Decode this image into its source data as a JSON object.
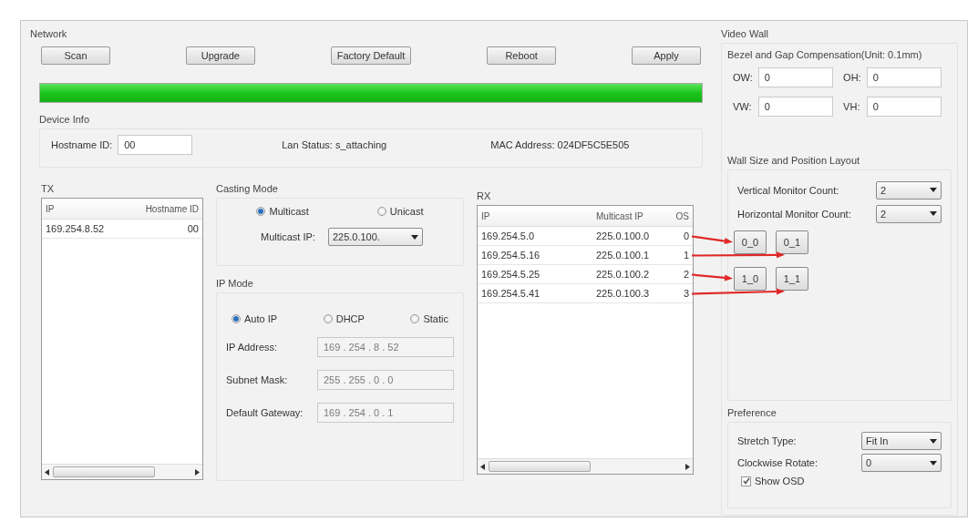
{
  "network": {
    "title": "Network",
    "buttons": [
      "Scan",
      "Upgrade",
      "Factory Default",
      "Reboot",
      "Apply"
    ],
    "progress": {
      "level": 1
    },
    "device_info": {
      "title": "Device Info",
      "hostname_label": "Hostname ID:",
      "hostname_value": "00",
      "lan_status": "Lan Status: s_attaching",
      "mac_address": "MAC Address: 024DF5C5E505"
    }
  },
  "tx": {
    "title": "TX",
    "columns": [
      "IP",
      "Hostname ID"
    ],
    "rows": [
      [
        "169.254.8.52",
        "00"
      ]
    ]
  },
  "casting_mode": {
    "title": "Casting Mode",
    "options": [
      {
        "label": "Multicast",
        "selected": true
      },
      {
        "label": "Unicast",
        "selected": false
      }
    ],
    "multicast_ip_label": "Multicast IP:",
    "multicast_ip": "225.0.100."
  },
  "ip_mode": {
    "title": "IP Mode",
    "options": [
      {
        "label": "Auto IP",
        "selected": true
      },
      {
        "label": "DHCP",
        "selected": false
      },
      {
        "label": "Static",
        "selected": false
      }
    ],
    "fields": [
      {
        "label": "IP Address:",
        "value": "169 . 254 . 8 . 52",
        "disabled": true
      },
      {
        "label": "Subnet Mask:",
        "value": "255 . 255 . 0 . 0",
        "disabled": true
      },
      {
        "label": "Default Gateway:",
        "value": "169 . 254 . 0 . 1",
        "disabled": true
      }
    ]
  },
  "rx": {
    "title": "RX",
    "columns": [
      "IP",
      "Multicast IP",
      "OS"
    ],
    "rows": [
      [
        "169.254.5.0",
        "225.0.100.0",
        "0"
      ],
      [
        "169.254.5.16",
        "225.0.100.1",
        "1"
      ],
      [
        "169.254.5.25",
        "225.0.100.2",
        "2"
      ],
      [
        "169.254.5.41",
        "225.0.100.3",
        "3"
      ]
    ]
  },
  "video_wall": {
    "title": "Video Wall",
    "bezel": {
      "title": "Bezel and Gap Compensation(Unit: 0.1mm)",
      "fields": [
        {
          "label": "OW:",
          "value": "0"
        },
        {
          "label": "OH:",
          "value": "0"
        },
        {
          "label": "VW:",
          "value": "0"
        },
        {
          "label": "VH:",
          "value": "0"
        }
      ]
    },
    "layout": {
      "title": "Wall Size and Position Layout",
      "combos": [
        {
          "label": "Vertical Monitor Count:",
          "value": "2"
        },
        {
          "label": "Horizontal Monitor Count:",
          "value": "2"
        }
      ],
      "tiles": [
        "0_0",
        "0_1",
        "1_0",
        "1_1"
      ]
    },
    "preference": {
      "title": "Preference",
      "combos": [
        {
          "label": "Stretch Type:",
          "value": "Fit In"
        },
        {
          "label": "Clockwise Rotate:",
          "value": "0"
        }
      ],
      "show_osd": {
        "label": "Show OSD",
        "checked": true
      }
    }
  }
}
